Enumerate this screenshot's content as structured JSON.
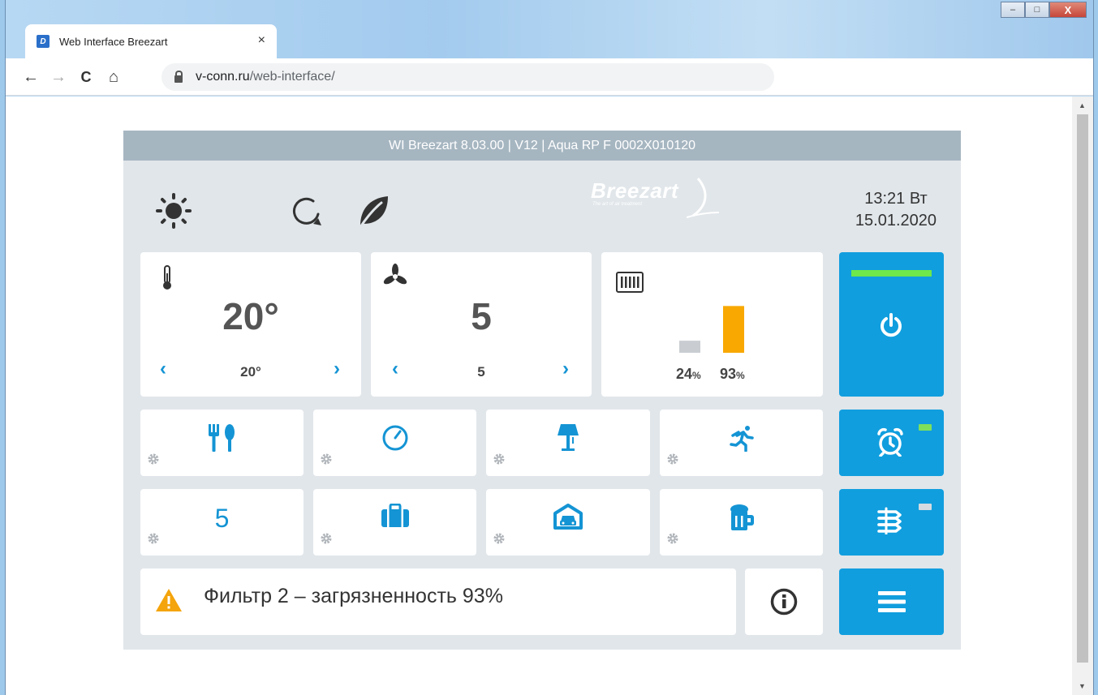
{
  "browser": {
    "tab_title": "Web Interface Breezart",
    "tab_close": "×",
    "favicon_letter": "D",
    "url_host": "v-conn.ru",
    "url_path": "/web-interface/",
    "nav": {
      "back": "←",
      "forward": "→",
      "reload": "C",
      "home": "⌂"
    },
    "window_controls": {
      "minimize": "–",
      "maximize": "□",
      "close": "X"
    }
  },
  "panel": {
    "header": "WI Breezart 8.03.00 | V12 | Aqua RP F 0002X010120",
    "logo": {
      "name": "Breezart",
      "tagline": "The art of air treatment"
    },
    "clock": {
      "time_day": "13:21 Вт",
      "date": "15.01.2020"
    },
    "temperature": {
      "value": "20°",
      "setpoint": "20°"
    },
    "fan": {
      "value": "5",
      "setpoint": "5"
    },
    "filters": {
      "filter1_pct": "24",
      "filter2_pct": "93",
      "unit": "%",
      "filter1_level": 0.24,
      "filter2_level": 0.93
    },
    "power": {
      "status_color": "#6ee84a"
    },
    "modes_row1": [
      "kitchen-icon",
      "timer-icon",
      "night-lamp-icon",
      "sport-icon"
    ],
    "modes_row2": {
      "preset_number": "5",
      "icons": [
        "vacation-icon",
        "garage-icon",
        "party-icon"
      ]
    },
    "alarm": {
      "indicator_color": "#7ee05a"
    },
    "zones": {
      "indicator_color": "#d5dbe0"
    },
    "alert": {
      "message": "Фильтр 2 – загрязненность 93%"
    },
    "colors": {
      "accent": "#109ede",
      "warning": "#f4a40c",
      "filter_bar": "#f8a800",
      "muted_bar": "#c9cdd1"
    }
  }
}
